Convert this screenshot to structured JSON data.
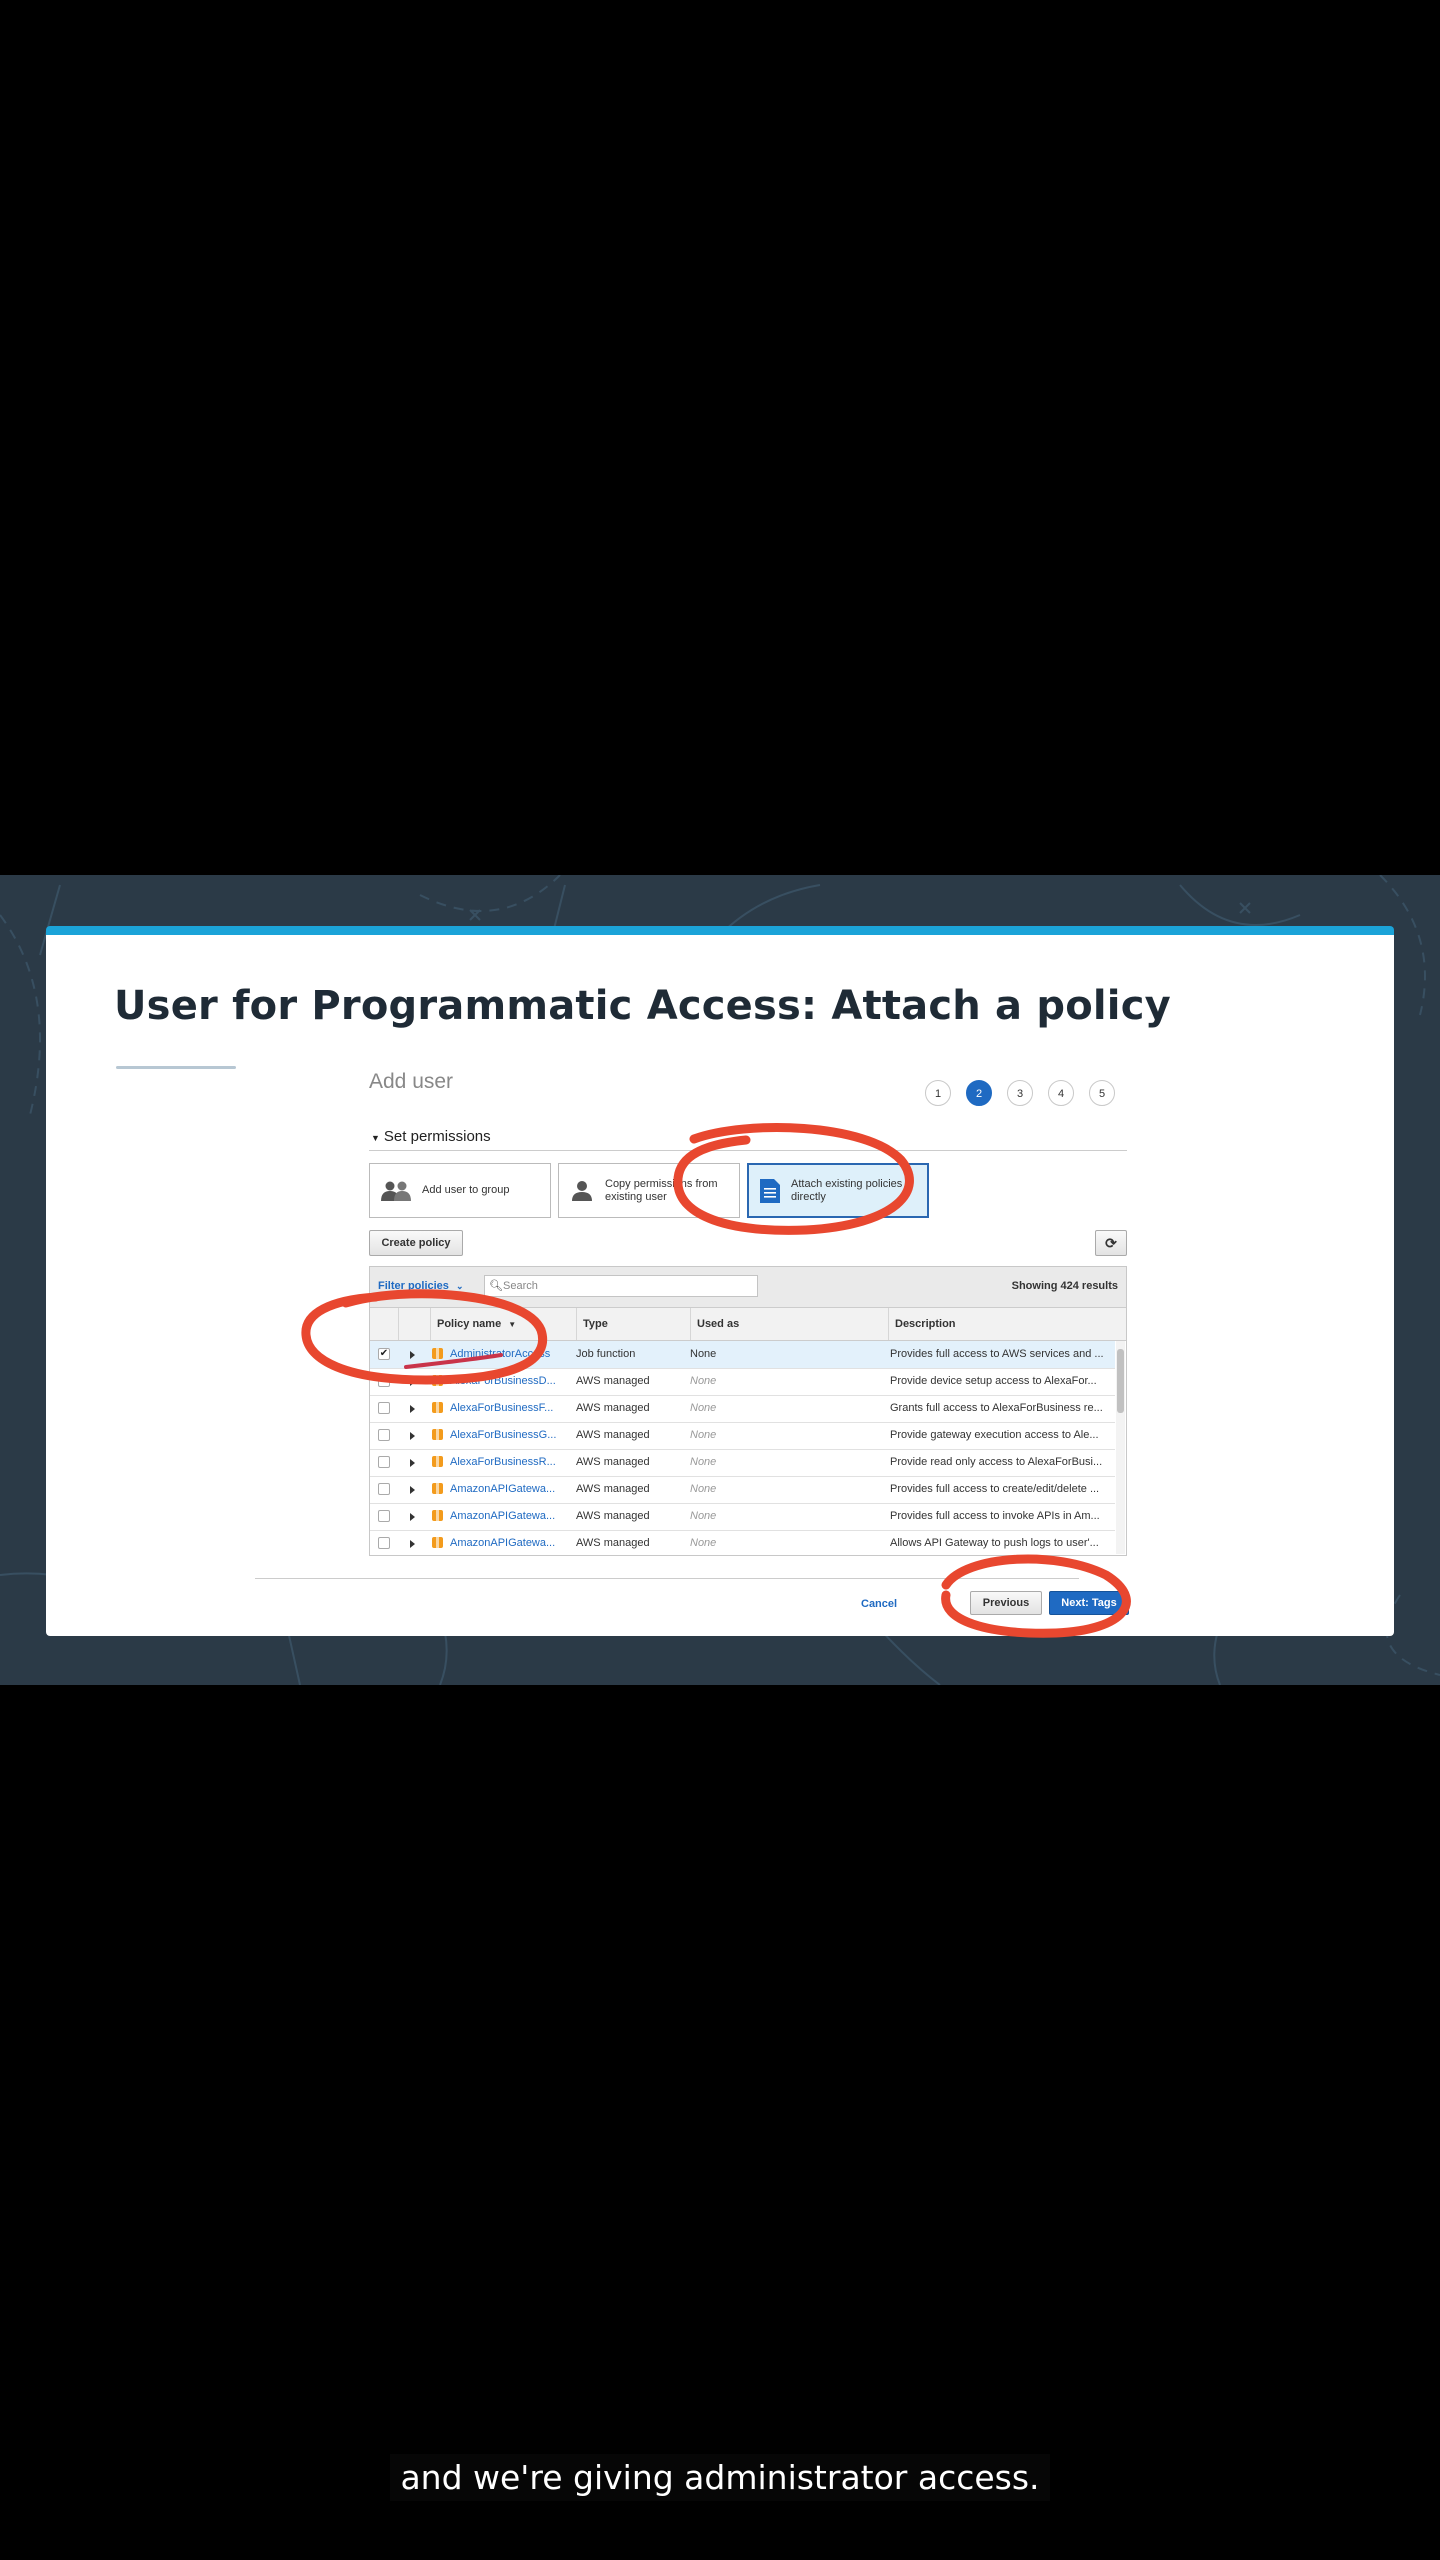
{
  "slide": {
    "title": "User for Programmatic Access:  Attach a policy"
  },
  "console": {
    "page_title": "Add user",
    "steps": [
      "1",
      "2",
      "3",
      "4",
      "5"
    ],
    "active_step": "2",
    "section_heading": "Set permissions",
    "permission_options": [
      {
        "label": "Add user to group",
        "icon": "users-group-icon",
        "selected": false
      },
      {
        "label": "Copy permissions from existing user",
        "icon": "user-icon",
        "selected": false
      },
      {
        "label": "Attach existing policies directly",
        "icon": "document-icon",
        "selected": true
      }
    ],
    "create_policy_label": "Create policy",
    "refresh_icon": "refresh-icon",
    "filter_label": "Filter policies",
    "search_placeholder": "Search",
    "results_text": "Showing 424 results",
    "columns": [
      "Policy name",
      "Type",
      "Used as",
      "Description"
    ],
    "rows": [
      {
        "selected": true,
        "name": "AdministratorAccess",
        "type": "Job function",
        "used_as": "None",
        "description": "Provides full access to AWS services and ..."
      },
      {
        "selected": false,
        "name": "AlexaForBusinessD...",
        "type": "AWS managed",
        "used_as": "None",
        "description": "Provide device setup access to AlexaFor..."
      },
      {
        "selected": false,
        "name": "AlexaForBusinessF...",
        "type": "AWS managed",
        "used_as": "None",
        "description": "Grants full access to AlexaForBusiness re..."
      },
      {
        "selected": false,
        "name": "AlexaForBusinessG...",
        "type": "AWS managed",
        "used_as": "None",
        "description": "Provide gateway execution access to Ale..."
      },
      {
        "selected": false,
        "name": "AlexaForBusinessR...",
        "type": "AWS managed",
        "used_as": "None",
        "description": "Provide read only access to AlexaForBusi..."
      },
      {
        "selected": false,
        "name": "AmazonAPIGatewa...",
        "type": "AWS managed",
        "used_as": "None",
        "description": "Provides full access to create/edit/delete ..."
      },
      {
        "selected": false,
        "name": "AmazonAPIGatewa...",
        "type": "AWS managed",
        "used_as": "None",
        "description": "Provides full access to invoke APIs in Am..."
      },
      {
        "selected": false,
        "name": "AmazonAPIGatewa...",
        "type": "AWS managed",
        "used_as": "None",
        "description": "Allows API Gateway to push logs to user'..."
      }
    ],
    "cancel_label": "Cancel",
    "previous_label": "Previous",
    "next_label": "Next: Tags"
  },
  "caption": "and we're giving administrator access.",
  "colors": {
    "accent_bar": "#1ba3d8",
    "aws_blue": "#1f6ac2",
    "annotation_red": "#e8472f",
    "background_band": "#2b3a47"
  }
}
